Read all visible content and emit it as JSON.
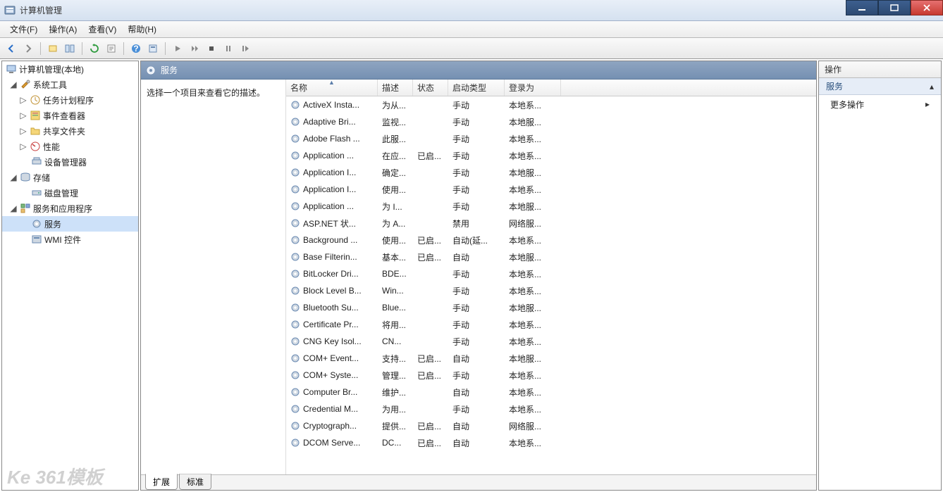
{
  "window": {
    "title": "计算机管理"
  },
  "menubar": {
    "file": "文件(F)",
    "action": "操作(A)",
    "view": "查看(V)",
    "help": "帮助(H)"
  },
  "toolbar_icons": [
    "back",
    "forward",
    "up",
    "console",
    "refresh",
    "export",
    "help",
    "properties",
    "run",
    "play-all",
    "stop",
    "pause",
    "restart"
  ],
  "tree": {
    "root": "计算机管理(本地)",
    "sys_tools": "系统工具",
    "task_sched": "任务计划程序",
    "event_viewer": "事件查看器",
    "shared": "共享文件夹",
    "perf": "性能",
    "devmgr": "设备管理器",
    "storage": "存储",
    "diskmgmt": "磁盘管理",
    "svc_app": "服务和应用程序",
    "services": "服务",
    "wmi": "WMI 控件"
  },
  "services_pane": {
    "title": "服务",
    "desc": "选择一个项目来查看它的描述。",
    "columns": {
      "name": "名称",
      "desc": "描述",
      "status": "状态",
      "startup": "启动类型",
      "logon": "登录为"
    },
    "rows": [
      {
        "name": "ActiveX Insta...",
        "desc": "为从...",
        "status": "",
        "startup": "手动",
        "logon": "本地系..."
      },
      {
        "name": "Adaptive Bri...",
        "desc": "监视...",
        "status": "",
        "startup": "手动",
        "logon": "本地服..."
      },
      {
        "name": "Adobe Flash ...",
        "desc": "此服...",
        "status": "",
        "startup": "手动",
        "logon": "本地系..."
      },
      {
        "name": "Application ...",
        "desc": "在应...",
        "status": "已启...",
        "startup": "手动",
        "logon": "本地系..."
      },
      {
        "name": "Application I...",
        "desc": "确定...",
        "status": "",
        "startup": "手动",
        "logon": "本地服..."
      },
      {
        "name": "Application I...",
        "desc": "使用...",
        "status": "",
        "startup": "手动",
        "logon": "本地系..."
      },
      {
        "name": "Application ...",
        "desc": "为 I...",
        "status": "",
        "startup": "手动",
        "logon": "本地服..."
      },
      {
        "name": "ASP.NET 状...",
        "desc": "为 A...",
        "status": "",
        "startup": "禁用",
        "logon": "网络服..."
      },
      {
        "name": "Background ...",
        "desc": "使用...",
        "status": "已启...",
        "startup": "自动(延...",
        "logon": "本地系..."
      },
      {
        "name": "Base Filterin...",
        "desc": "基本...",
        "status": "已启...",
        "startup": "自动",
        "logon": "本地服..."
      },
      {
        "name": "BitLocker Dri...",
        "desc": "BDE...",
        "status": "",
        "startup": "手动",
        "logon": "本地系..."
      },
      {
        "name": "Block Level B...",
        "desc": "Win...",
        "status": "",
        "startup": "手动",
        "logon": "本地系..."
      },
      {
        "name": "Bluetooth Su...",
        "desc": "Blue...",
        "status": "",
        "startup": "手动",
        "logon": "本地服..."
      },
      {
        "name": "Certificate Pr...",
        "desc": "将用...",
        "status": "",
        "startup": "手动",
        "logon": "本地系..."
      },
      {
        "name": "CNG Key Isol...",
        "desc": "CN...",
        "status": "",
        "startup": "手动",
        "logon": "本地系..."
      },
      {
        "name": "COM+ Event...",
        "desc": "支持...",
        "status": "已启...",
        "startup": "自动",
        "logon": "本地服..."
      },
      {
        "name": "COM+ Syste...",
        "desc": "管理...",
        "status": "已启...",
        "startup": "手动",
        "logon": "本地系..."
      },
      {
        "name": "Computer Br...",
        "desc": "维护...",
        "status": "",
        "startup": "自动",
        "logon": "本地系..."
      },
      {
        "name": "Credential M...",
        "desc": "为用...",
        "status": "",
        "startup": "手动",
        "logon": "本地系..."
      },
      {
        "name": "Cryptograph...",
        "desc": "提供...",
        "status": "已启...",
        "startup": "自动",
        "logon": "网络服..."
      },
      {
        "name": "DCOM Serve...",
        "desc": "DC...",
        "status": "已启...",
        "startup": "自动",
        "logon": "本地系..."
      }
    ],
    "tabs": {
      "extended": "扩展",
      "standard": "标准"
    }
  },
  "actions": {
    "header": "操作",
    "section": "服务",
    "more": "更多操作"
  },
  "watermark": "Ke 361模板"
}
